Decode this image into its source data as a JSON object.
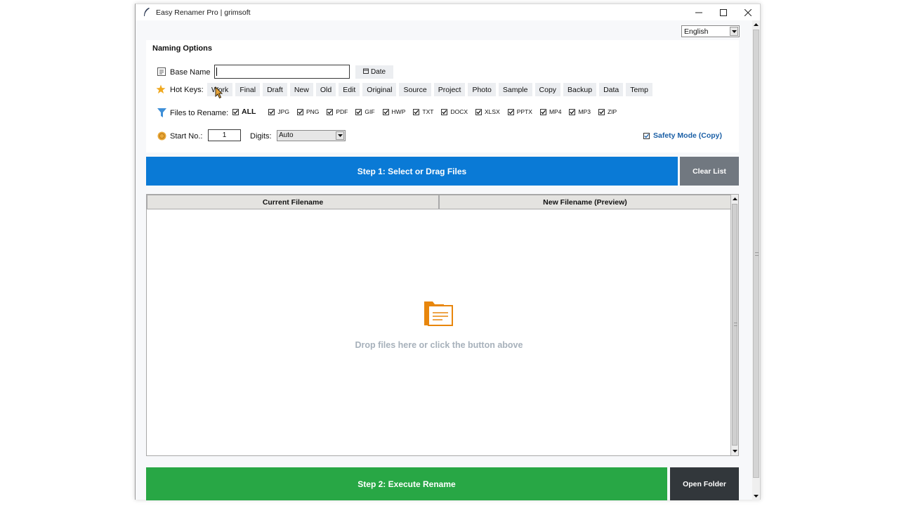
{
  "window": {
    "title": "Easy Renamer Pro | grimsoft"
  },
  "language": {
    "selected": "English"
  },
  "options": {
    "section_title": "Naming Options",
    "base_name_label": "Base Name",
    "base_name_value": "",
    "date_button": "Date",
    "hotkeys_label": "Hot Keys:",
    "hotkeys": [
      "Work",
      "Final",
      "Draft",
      "New",
      "Old",
      "Edit",
      "Original",
      "Source",
      "Project",
      "Photo",
      "Sample",
      "Copy",
      "Backup",
      "Data",
      "Temp"
    ],
    "files_label": "Files to Rename:",
    "all_label": "ALL",
    "extensions": [
      "JPG",
      "PNG",
      "PDF",
      "GIF",
      "HWP",
      "TXT",
      "DOCX",
      "XLSX",
      "PPTX",
      "MP4",
      "MP3",
      "ZIP"
    ],
    "start_label": "Start No.:",
    "start_value": "1",
    "digits_label": "Digits:",
    "digits_value": "Auto",
    "safety_label": "Safety Mode (Copy)"
  },
  "actions": {
    "step1": "Step 1: Select or Drag Files",
    "clear": "Clear List",
    "step2": "Step 2: Execute Rename",
    "open_folder": "Open Folder"
  },
  "table": {
    "columns": [
      "Current Filename",
      "New Filename (Preview)"
    ],
    "empty_text": "Drop files here or click the button above"
  },
  "colors": {
    "primary": "#0a7ad6",
    "success": "#28a745",
    "secondary": "#717880",
    "dark": "#32373b",
    "accent_orange": "#e8860c",
    "link_blue": "#1a5fa6"
  },
  "icons": {
    "app": "feather-icon",
    "base_name": "text-lines-icon",
    "date": "calendar-icon",
    "hotkeys": "star-icon",
    "files": "filter-icon",
    "start": "coin-icon",
    "empty": "folder-document-icon"
  }
}
